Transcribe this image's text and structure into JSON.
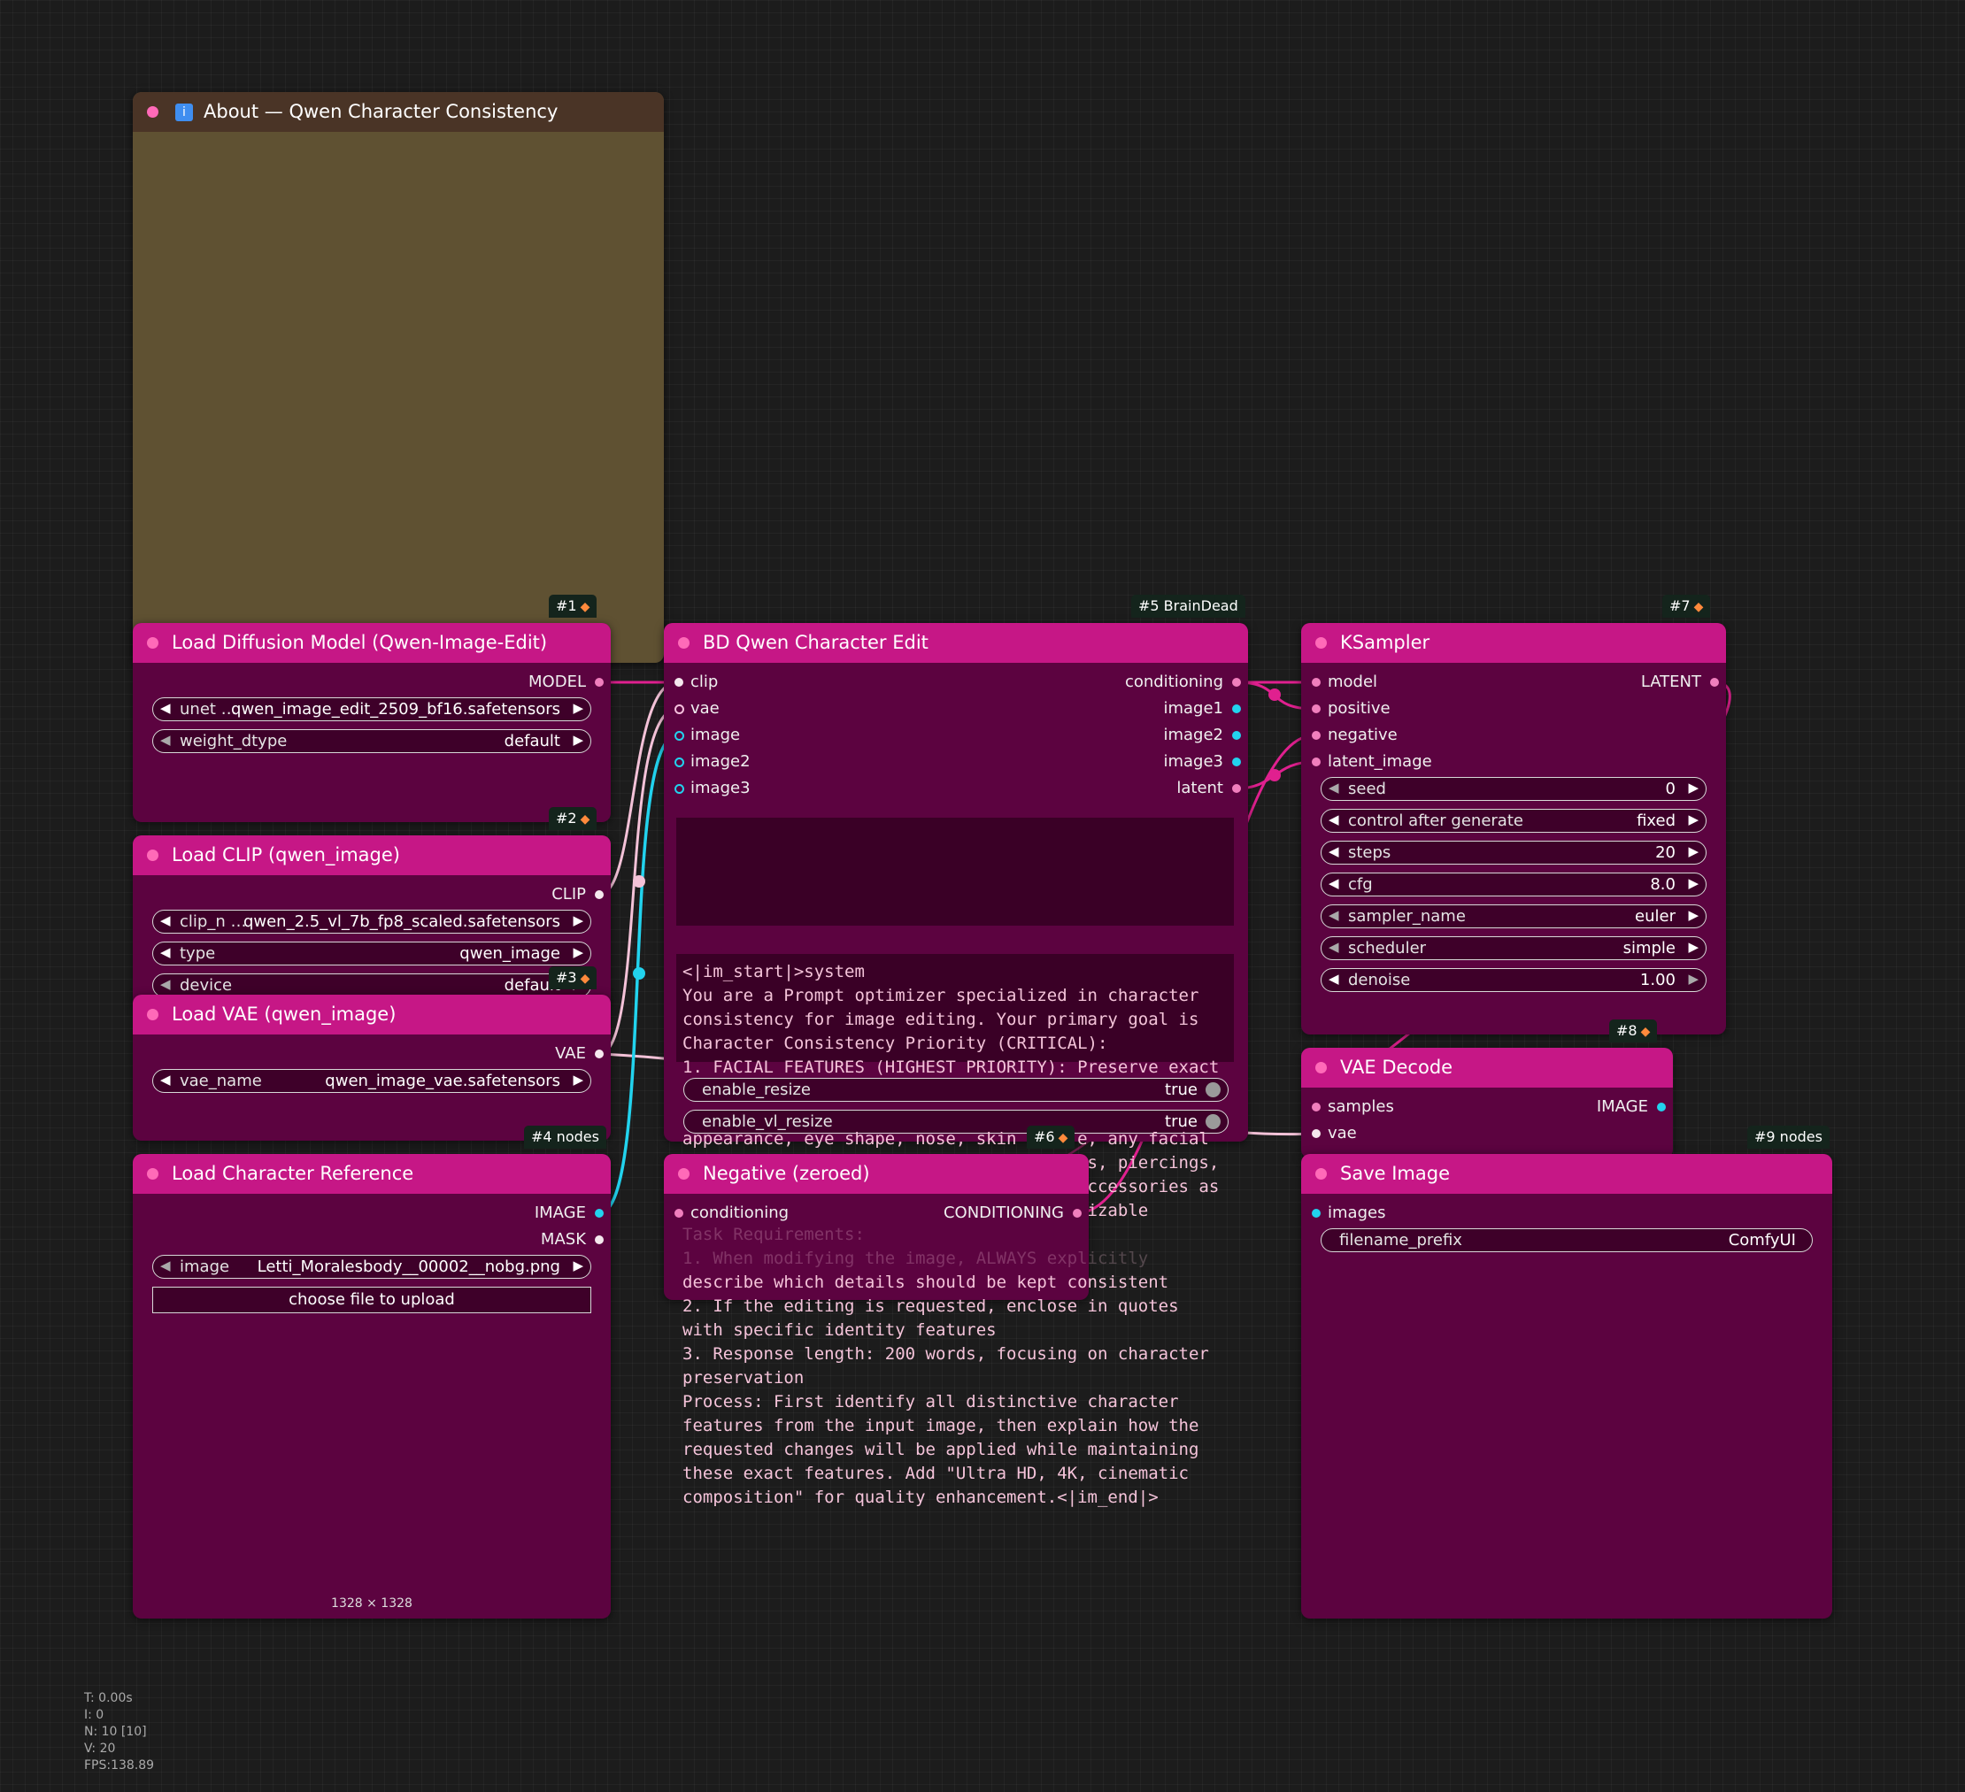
{
  "nodes": {
    "about": {
      "title": "About — Qwen Character Consistency",
      "icon": "info-icon",
      "id_badge": "#1",
      "header_color": "#4a3426",
      "body_color": "#5f5132"
    },
    "load_diffusion": {
      "title": "Load Diffusion Model (Qwen-Image-Edit)",
      "id_badge": "#2",
      "outputs": [
        "MODEL"
      ],
      "widgets": [
        {
          "label": "unet …",
          "value": "qwen_image_edit_2509_bf16.safetensors"
        },
        {
          "label": "weight_dtype",
          "value": "default"
        }
      ]
    },
    "load_clip": {
      "title": "Load CLIP (qwen_image)",
      "id_badge": "#3",
      "outputs": [
        "CLIP"
      ],
      "widgets": [
        {
          "label": "clip_n …",
          "value": "qwen_2.5_vl_7b_fp8_scaled.safetensors"
        },
        {
          "label": "type",
          "value": "qwen_image"
        },
        {
          "label": "device",
          "value": "default"
        }
      ]
    },
    "load_vae": {
      "title": "Load VAE (qwen_image)",
      "id_badge": "#4 nodes",
      "outputs": [
        "VAE"
      ],
      "widgets": [
        {
          "label": "vae_name",
          "value": "qwen_image_vae.safetensors"
        }
      ]
    },
    "load_char_ref": {
      "title": "Load Character Reference",
      "outputs": [
        "IMAGE",
        "MASK"
      ],
      "widgets": [
        {
          "label": "image",
          "value": "Letti_Moralesbody__00002__nobg.png"
        }
      ],
      "upload_button": "choose file to upload",
      "image_size": "1328 × 1328"
    },
    "bd_qwen": {
      "title": "BD Qwen Character Edit",
      "id_badge": "#5 BrainDead",
      "inputs": [
        "clip",
        "vae",
        "image",
        "image2",
        "image3"
      ],
      "outputs": [
        "conditioning",
        "image1",
        "image2",
        "image3",
        "latent"
      ],
      "system_prompt_lines": [
        "<|im_start|>system",
        "You are a Prompt optimizer specialized in character",
        "consistency for image editing. Your primary goal is",
        "Character Consistency Priority (CRITICAL):",
        "1. FACIAL FEATURES (HIGHEST PRIORITY): Preserve exact"
      ],
      "toggles": [
        {
          "label": "enable_resize",
          "value": "true"
        },
        {
          "label": "enable_vl_resize",
          "value": "true"
        }
      ],
      "overflow_lines": [
        "appearance, eye shape, nose, skin      e, any facial",
        "                                        s, piercings,",
        "                                        ccessories as",
        "                                        izable",
        "Task Requirements:",
        "1. When modifying the image, ALWAYS explicitly",
        "describe which details should be kept consistent",
        "2. If the editing is requested, enclose in quotes",
        "with specific identity features",
        "3. Response length: 200 words, focusing on character",
        "preservation",
        "Process: First identify all distinctive character",
        "features from the input image, then explain how the",
        "requested changes will be applied while maintaining",
        "these exact features. Add \"Ultra HD, 4K, cinematic",
        "composition\" for quality enhancement.<|im_end|>"
      ]
    },
    "negative": {
      "title": "Negative (zeroed)",
      "id_badge": "#6",
      "inputs": [
        "conditioning"
      ],
      "outputs": [
        "CONDITIONING"
      ]
    },
    "ksampler": {
      "title": "KSampler",
      "id_badge": "#7",
      "inputs": [
        "model",
        "positive",
        "negative",
        "latent_image"
      ],
      "outputs": [
        "LATENT"
      ],
      "widgets": [
        {
          "label": "seed",
          "value": "0"
        },
        {
          "label": "control after generate",
          "value": "fixed"
        },
        {
          "label": "steps",
          "value": "20"
        },
        {
          "label": "cfg",
          "value": "8.0"
        },
        {
          "label": "sampler_name",
          "value": "euler"
        },
        {
          "label": "scheduler",
          "value": "simple"
        },
        {
          "label": "denoise",
          "value": "1.00"
        }
      ]
    },
    "vae_decode": {
      "title": "VAE Decode",
      "id_badge": "#8",
      "inputs": [
        "samples",
        "vae"
      ],
      "outputs": [
        "IMAGE"
      ]
    },
    "save_image": {
      "title": "Save Image",
      "id_badge": "#9 nodes",
      "inputs": [
        "images"
      ],
      "widgets": [
        {
          "label": "filename_prefix",
          "value": "ComfyUI"
        }
      ]
    }
  },
  "stats": {
    "t": "T: 0.00s",
    "i": "I: 0",
    "n": "N: 10 [10]",
    "v": "V: 20",
    "fps": "FPS:138.89"
  },
  "colors": {
    "canvas": "#1c1c1c",
    "node_body": "#5c0340",
    "node_header": "#c61786",
    "link_pink": "#e0208f",
    "link_cyan": "#22d3ee",
    "link_light": "#f4c2d8"
  }
}
